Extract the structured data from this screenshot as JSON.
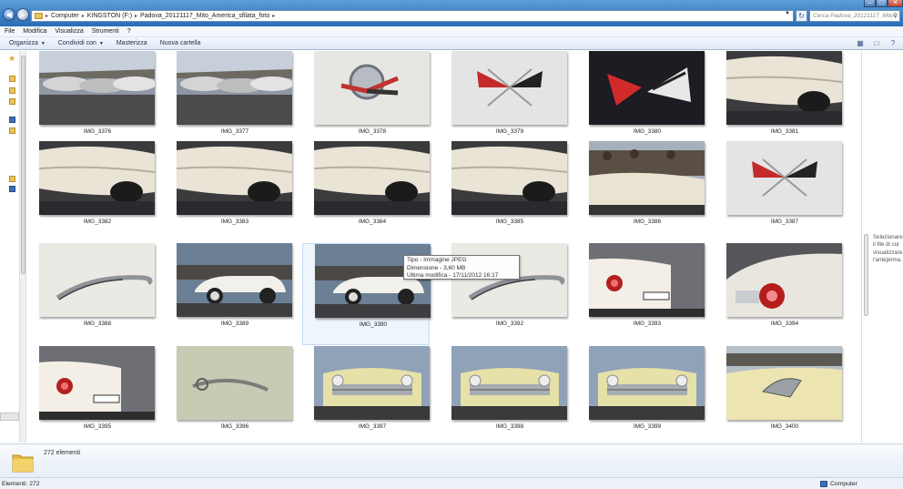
{
  "window": {
    "breadcrumb": [
      "Computer",
      "KINGSTON (F:)",
      "Padova_20121117_Mito_America_sfilata_foto"
    ],
    "search_placeholder": "Cerca Padova_20121117_Mito..."
  },
  "menu": [
    "File",
    "Modifica",
    "Visualizza",
    "Strumenti",
    "?"
  ],
  "toolbar": {
    "organizza": "Organizza",
    "condividi": "Condividi con",
    "masterizza": "Masterizza",
    "nuova_cartella": "Nuova cartella"
  },
  "files": [
    {
      "name": "IMG_3376",
      "scene": "lot"
    },
    {
      "name": "IMG_3377",
      "scene": "lot"
    },
    {
      "name": "IMG_3378",
      "scene": "emblem-silver"
    },
    {
      "name": "IMG_3379",
      "scene": "emblem-flags"
    },
    {
      "name": "IMG_3380",
      "scene": "emblem-red"
    },
    {
      "name": "IMG_3381",
      "scene": "white-car"
    },
    {
      "name": "IMG_3382",
      "scene": "white-car"
    },
    {
      "name": "IMG_3383",
      "scene": "white-car"
    },
    {
      "name": "IMG_3384",
      "scene": "white-car"
    },
    {
      "name": "IMG_3385",
      "scene": "white-car"
    },
    {
      "name": "IMG_3386",
      "scene": "crowd-car"
    },
    {
      "name": "IMG_3387",
      "scene": "emblem-flags"
    },
    {
      "name": "IMG_3388",
      "scene": "script"
    },
    {
      "name": "IMG_3389",
      "scene": "tbird"
    },
    {
      "name": "IMG_3390",
      "scene": "tbird",
      "selected": true
    },
    {
      "name": "IMG_3392",
      "scene": "script"
    },
    {
      "name": "IMG_3393",
      "scene": "tail"
    },
    {
      "name": "IMG_3394",
      "scene": "tail-close"
    },
    {
      "name": "IMG_3395",
      "scene": "tail"
    },
    {
      "name": "IMG_3396",
      "scene": "script-green"
    },
    {
      "name": "IMG_3397",
      "scene": "buick"
    },
    {
      "name": "IMG_3398",
      "scene": "buick"
    },
    {
      "name": "IMG_3399",
      "scene": "buick"
    },
    {
      "name": "IMG_3400",
      "scene": "ornament"
    }
  ],
  "tooltip": {
    "tipo": "Tipo - Immagine JPEG",
    "dimensione": "Dimensione - 3,60 MB",
    "modifica": "Ultima modifica - 17/11/2012 16:17"
  },
  "preview_pane": {
    "line1": "Selezionare",
    "line2": "il file di cui",
    "line3": "visualizzare",
    "line4": "l'anteprima."
  },
  "details": {
    "count": "272 elementi"
  },
  "status": {
    "left": "Elementi: 272",
    "right": "Computer"
  }
}
